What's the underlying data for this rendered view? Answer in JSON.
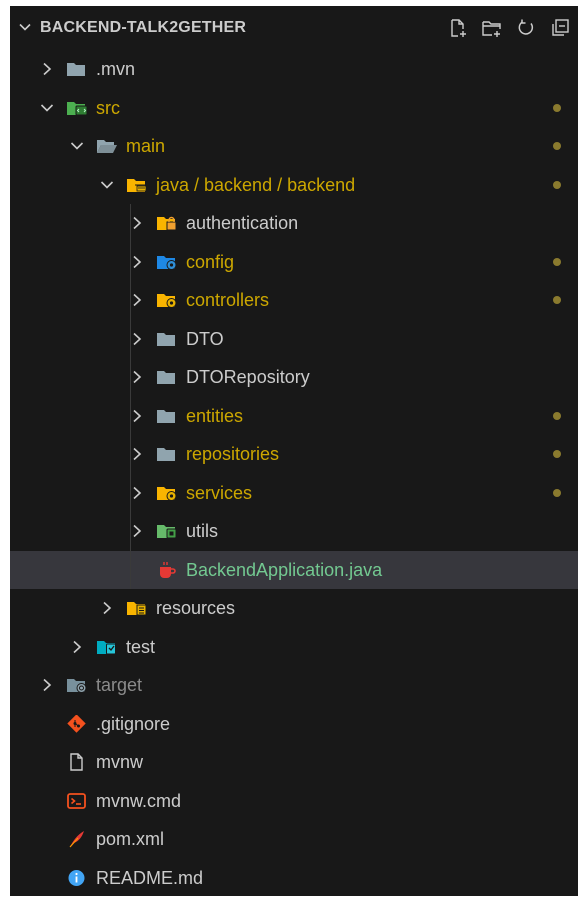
{
  "explorer": {
    "title": "BACKEND-TALK2GETHER",
    "actions": [
      {
        "name": "new-file-icon"
      },
      {
        "name": "new-folder-icon"
      },
      {
        "name": "refresh-icon"
      },
      {
        "name": "collapse-all-icon"
      }
    ]
  },
  "colors": {
    "background": "#181818",
    "modified_text": "#cca700",
    "untracked_text": "#73c991",
    "default_text": "#cccccc",
    "ignored_text": "#8b8b8b",
    "modified_dot": "#8a7a2e",
    "selection": "#37373d"
  },
  "tree": [
    {
      "label": ".mvn",
      "depth": 0,
      "type": "folder",
      "expanded": false,
      "status": "default",
      "icon": "folder-icon",
      "dot": false
    },
    {
      "label": "src",
      "depth": 0,
      "type": "folder",
      "expanded": true,
      "status": "modified",
      "icon": "folder-src-icon",
      "dot": true
    },
    {
      "label": "main",
      "depth": 1,
      "type": "folder",
      "expanded": true,
      "status": "modified",
      "icon": "folder-open-icon",
      "dot": true
    },
    {
      "label": "java / backend / backend",
      "depth": 2,
      "type": "folder",
      "expanded": true,
      "status": "modified",
      "icon": "folder-java-icon",
      "dot": true
    },
    {
      "label": "authentication",
      "depth": 3,
      "type": "folder",
      "expanded": false,
      "status": "default",
      "icon": "folder-lock-icon",
      "dot": false
    },
    {
      "label": "config",
      "depth": 3,
      "type": "folder",
      "expanded": false,
      "status": "modified",
      "icon": "folder-config-icon",
      "dot": true
    },
    {
      "label": "controllers",
      "depth": 3,
      "type": "folder",
      "expanded": false,
      "status": "modified",
      "icon": "folder-controllers-icon",
      "dot": true
    },
    {
      "label": "DTO",
      "depth": 3,
      "type": "folder",
      "expanded": false,
      "status": "default",
      "icon": "folder-icon",
      "dot": false
    },
    {
      "label": "DTORepository",
      "depth": 3,
      "type": "folder",
      "expanded": false,
      "status": "default",
      "icon": "folder-icon",
      "dot": false
    },
    {
      "label": "entities",
      "depth": 3,
      "type": "folder",
      "expanded": false,
      "status": "modified",
      "icon": "folder-icon",
      "dot": true
    },
    {
      "label": "repositories",
      "depth": 3,
      "type": "folder",
      "expanded": false,
      "status": "modified",
      "icon": "folder-icon",
      "dot": true
    },
    {
      "label": "services",
      "depth": 3,
      "type": "folder",
      "expanded": false,
      "status": "modified",
      "icon": "folder-services-icon",
      "dot": true
    },
    {
      "label": "utils",
      "depth": 3,
      "type": "folder",
      "expanded": false,
      "status": "default",
      "icon": "folder-utils-icon",
      "dot": false
    },
    {
      "label": "BackendApplication.java",
      "depth": 3,
      "type": "file",
      "status": "untracked",
      "icon": "java-file-icon",
      "dot": false,
      "selected": true
    },
    {
      "label": "resources",
      "depth": 2,
      "type": "folder",
      "expanded": false,
      "status": "default",
      "icon": "folder-resources-icon",
      "dot": false
    },
    {
      "label": "test",
      "depth": 1,
      "type": "folder",
      "expanded": false,
      "status": "default",
      "icon": "folder-test-icon",
      "dot": false
    },
    {
      "label": "target",
      "depth": 0,
      "type": "folder",
      "expanded": false,
      "status": "ignored",
      "icon": "folder-target-icon",
      "dot": false
    },
    {
      "label": ".gitignore",
      "depth": 0,
      "type": "file",
      "status": "default",
      "icon": "git-icon",
      "dot": false
    },
    {
      "label": "mvnw",
      "depth": 0,
      "type": "file",
      "status": "default",
      "icon": "file-icon",
      "dot": false
    },
    {
      "label": "mvnw.cmd",
      "depth": 0,
      "type": "file",
      "status": "default",
      "icon": "terminal-icon",
      "dot": false
    },
    {
      "label": "pom.xml",
      "depth": 0,
      "type": "file",
      "status": "default",
      "icon": "maven-feather-icon",
      "dot": false
    },
    {
      "label": "README.md",
      "depth": 0,
      "type": "file",
      "status": "default",
      "icon": "info-icon",
      "dot": false
    }
  ]
}
